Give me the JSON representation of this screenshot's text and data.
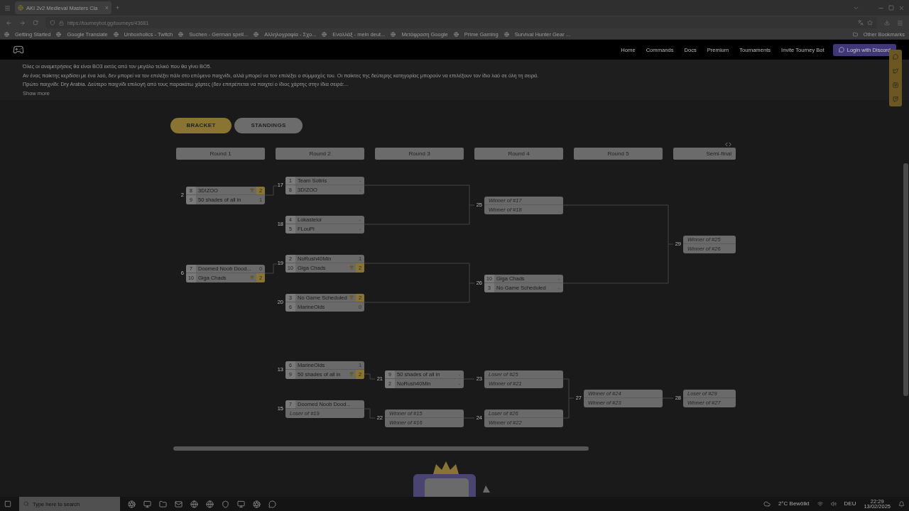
{
  "browser": {
    "tab": {
      "title": "AKI 2v2 Medieval Masters Cla",
      "close": "×"
    },
    "new_tab": "+",
    "url": "https://tourneybot.gg/tourneys/43681",
    "bookmarks": [
      "Getting Started",
      "Google Translate",
      "Unboxholics - Twitch",
      "Suchen - German spell...",
      "Αλληλογραφία - Σχο...",
      "Εναλλάξ - mein deut...",
      "Μετάφραση Google",
      "Prime Gaming",
      "Survival Hunter Gear ..."
    ],
    "other_bookmarks": "Other Bookmarks"
  },
  "nav": {
    "links": [
      "Home",
      "Commands",
      "Docs",
      "Premium",
      "Tournaments",
      "Invite Tourney Bot"
    ],
    "login": "Login with Discord"
  },
  "description": {
    "lines": [
      "Όλες οι αναμετρήσεις θα είναι BO3 εκτός από τον μεγάλο τελικό που θα γίνει BO5.",
      "Αν ένας παίκτης κερδίσει με ένα λαό, δεν μπορεί να τον επιλέξει πάλι στο επόμενο παιχνίδι, αλλά μπορεί να τον επιλέξει ο σύμμαχός του. Οι παίκτες της δεύτερης κατηγορίας μπορούν να επιλέξουν τον ίδιο λαό σε όλη τη σειρά.",
      "Πρώτο παιχνίδι: Dry Arabia. Δεύτερο παιχνίδι επιλογή από τους παρακάτω χάρτες (δεν επιτρέπεται να παιχτεί ο ίδιος χάρτης στην ίδια σειρά:..."
    ],
    "show_more": "Show more"
  },
  "view_tabs": [
    {
      "label": "BRACKET",
      "selected": true
    },
    {
      "label": "STANDINGS",
      "selected": false
    }
  ],
  "bracket": {
    "rounds": [
      {
        "label": "Round 1"
      },
      {
        "label": "Round 2"
      },
      {
        "label": "Round 3"
      },
      {
        "label": "Round 4"
      },
      {
        "label": "Round 5"
      },
      {
        "label": "Semi-final"
      }
    ],
    "matches": [
      {
        "number": "2",
        "slots": [
          {
            "kind": "team",
            "seed": "8",
            "name": "3D!ZOO",
            "score": "2",
            "winner": true
          },
          {
            "kind": "team",
            "seed": "9",
            "name": "50 shades of all in",
            "score": "1",
            "winner": false
          }
        ]
      },
      {
        "number": "17",
        "slots": [
          {
            "kind": "team",
            "seed": "1",
            "name": "Team Sotiris",
            "score": "-",
            "winner": false
          },
          {
            "kind": "team",
            "seed": "8",
            "name": "3D!ZOO",
            "score": "-",
            "winner": false
          }
        ]
      },
      {
        "number": "18",
        "slots": [
          {
            "kind": "team",
            "seed": "4",
            "name": "Lokasteloi",
            "score": "-",
            "winner": false
          },
          {
            "kind": "team",
            "seed": "5",
            "name": "FLouPi",
            "score": "-",
            "winner": false
          }
        ]
      },
      {
        "number": "6",
        "slots": [
          {
            "kind": "team",
            "seed": "7",
            "name": "Doomed Noob Dood...",
            "score": "0",
            "winner": false
          },
          {
            "kind": "team",
            "seed": "10",
            "name": "Giga Chads",
            "score": "2",
            "winner": true
          }
        ]
      },
      {
        "number": "19",
        "slots": [
          {
            "kind": "team",
            "seed": "2",
            "name": "NoRush40Min",
            "score": "1",
            "winner": false
          },
          {
            "kind": "team",
            "seed": "10",
            "name": "Giga Chads",
            "score": "2",
            "winner": true
          }
        ]
      },
      {
        "number": "20",
        "slots": [
          {
            "kind": "team",
            "seed": "3",
            "name": "No Game Scheduled",
            "score": "2",
            "winner": true
          },
          {
            "kind": "team",
            "seed": "6",
            "name": "MarineOlds",
            "score": "0",
            "winner": false
          }
        ]
      },
      {
        "number": "25",
        "slots": [
          {
            "kind": "placeholder",
            "name": "Winner of #17"
          },
          {
            "kind": "placeholder",
            "name": "Winner of #18"
          }
        ]
      },
      {
        "number": "26",
        "slots": [
          {
            "kind": "team",
            "seed": "10",
            "name": "Giga Chads",
            "score": "-",
            "winner": false
          },
          {
            "kind": "team",
            "seed": "3",
            "name": "No Game Scheduled",
            "score": "-",
            "winner": false
          }
        ]
      },
      {
        "number": "29",
        "slots": [
          {
            "kind": "placeholder",
            "name": "Winner of #25"
          },
          {
            "kind": "placeholder",
            "name": "Winner of #26"
          }
        ]
      },
      {
        "number": "13",
        "slots": [
          {
            "kind": "team",
            "seed": "6",
            "name": "MarineOlds",
            "score": "1",
            "winner": false
          },
          {
            "kind": "team",
            "seed": "9",
            "name": "50 shades of all in",
            "score": "2",
            "winner": true
          }
        ]
      },
      {
        "number": "15",
        "slots": [
          {
            "kind": "team",
            "seed": "7",
            "name": "Doomed Noob Dood..."
          },
          {
            "kind": "placeholder",
            "name": "Loser of #19"
          }
        ]
      },
      {
        "number": "21",
        "slots": [
          {
            "kind": "team",
            "seed": "9",
            "name": "50 shades of all in",
            "score": "-",
            "winner": false
          },
          {
            "kind": "team",
            "seed": "2",
            "name": "NoRush40Min",
            "score": "-",
            "winner": false
          }
        ]
      },
      {
        "number": "22",
        "slots": [
          {
            "kind": "placeholder",
            "name": "Winner of #15"
          },
          {
            "kind": "placeholder",
            "name": "Winner of #16"
          }
        ]
      },
      {
        "number": "23",
        "slots": [
          {
            "kind": "placeholder",
            "name": "Loser of #25"
          },
          {
            "kind": "placeholder",
            "name": "Winner of #21"
          }
        ]
      },
      {
        "number": "24",
        "slots": [
          {
            "kind": "placeholder",
            "name": "Loser of #26"
          },
          {
            "kind": "placeholder",
            "name": "Winner of #22"
          }
        ]
      },
      {
        "number": "27",
        "slots": [
          {
            "kind": "placeholder",
            "name": "Winner of #24"
          },
          {
            "kind": "placeholder",
            "name": "Winner of #23"
          }
        ]
      },
      {
        "number": "28",
        "slots": [
          {
            "kind": "placeholder",
            "name": "Loser of #29"
          },
          {
            "kind": "placeholder",
            "name": "Winner of #27"
          }
        ]
      }
    ]
  },
  "taskbar": {
    "search_placeholder": "Type here to search",
    "weather": "2°C Bewölkt",
    "language": "DEU",
    "time": "22:29",
    "date": "13/02/2025"
  }
}
